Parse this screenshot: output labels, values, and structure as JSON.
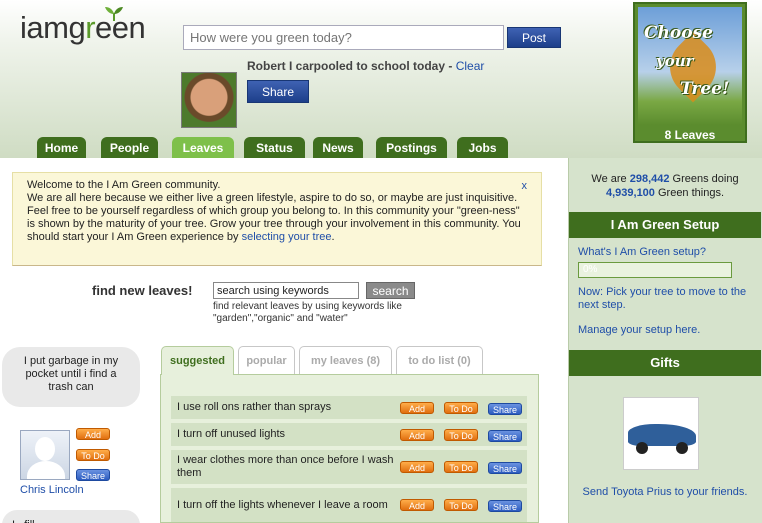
{
  "logo": {
    "pre": "iamg",
    "g": "r",
    "post": "een"
  },
  "status_box": {
    "placeholder": "How were you green today?",
    "post_label": "Post"
  },
  "status_update": {
    "text": "Robert I carpooled to school today - ",
    "clear_label": "Clear",
    "share_label": "Share"
  },
  "tree": {
    "line1": "Choose",
    "line2": "your",
    "line3": "Tree!",
    "caption": "8 Leaves"
  },
  "nav": [
    {
      "label": "Home",
      "active": false
    },
    {
      "label": "People",
      "active": false
    },
    {
      "label": "Leaves",
      "active": true
    },
    {
      "label": "Status",
      "active": false
    },
    {
      "label": "News",
      "active": false
    },
    {
      "label": "Postings",
      "active": false
    },
    {
      "label": "Jobs",
      "active": false
    }
  ],
  "welcome": {
    "body": "Welcome to the I Am Green community.\nWe are all here because we either live a green lifestyle, aspire to do so, or maybe are just inquisitive. Feel free to be yourself regardless of which group you belong to. In this community your \"green-ness\" is shown by the maturity of your tree. Grow your tree through your involvement in this community. You should start your I Am Green experience by ",
    "link": "selecting your tree",
    "end": ".",
    "close": "x"
  },
  "find": {
    "label": "find new leaves!",
    "input_value": "search using keywords",
    "button": "search",
    "help": "find relevant leaves by using keywords like \"garden\",\"organic\" and \"water\""
  },
  "feed": {
    "bubble1": "I put garbage in my pocket until i find a trash can",
    "person_name": "Chris Lincoln",
    "bubble2": "I...fill..."
  },
  "buttons": {
    "add": "Add",
    "todo": "To Do",
    "share": "Share"
  },
  "leaf_tabs": [
    "suggested",
    "popular",
    "my leaves (8)",
    "to do list (0)"
  ],
  "leaves": [
    "I use roll ons rather than sprays",
    "I turn off unused lights",
    "I wear clothes more than once before I wash them",
    "I turn off the lights whenever I leave a room"
  ],
  "right": {
    "count_pre": "We are ",
    "greens": "298,442",
    "count_mid": " Greens doing",
    "things": "4,939,100",
    "count_post": " Green things.",
    "setup_head": "I Am Green Setup",
    "whats_setup": "What's I Am Green setup?",
    "progress": "0%",
    "next_step": "Now: Pick your tree to move to the next step.",
    "manage": "Manage your setup here.",
    "gifts_head": "Gifts",
    "gift_text": "Send Toyota Prius to your friends."
  }
}
